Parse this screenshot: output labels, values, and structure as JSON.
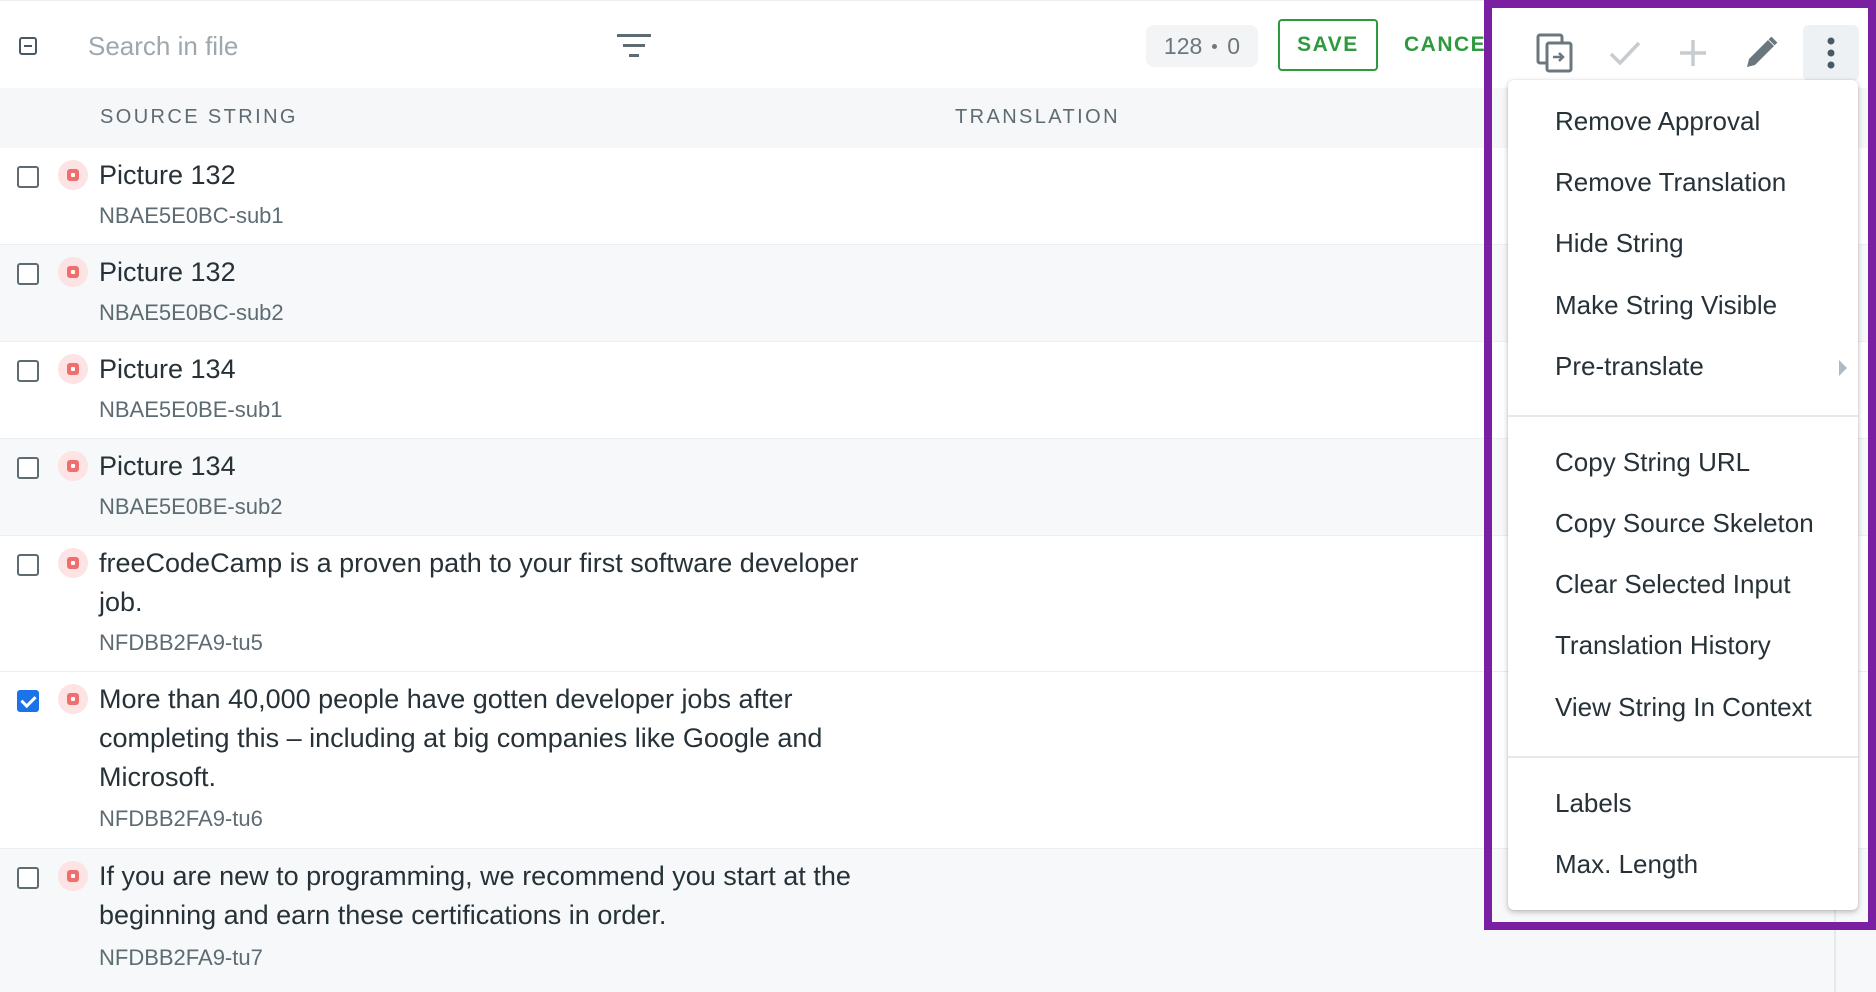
{
  "toolbar": {
    "search_placeholder": "Search in file",
    "count_left": "128",
    "count_right": "0",
    "save_label": "SAVE",
    "cancel_label": "CANCEL"
  },
  "table": {
    "source_header": "SOURCE STRING",
    "translation_header": "TRANSLATION"
  },
  "rows": [
    {
      "text": "Picture 132",
      "id": "NBAE5E0BC-sub1",
      "checked": false
    },
    {
      "text": "Picture 132",
      "id": "NBAE5E0BC-sub2",
      "checked": false
    },
    {
      "text": "Picture 134",
      "id": "NBAE5E0BE-sub1",
      "checked": false
    },
    {
      "text": "Picture 134",
      "id": "NBAE5E0BE-sub2",
      "checked": false
    },
    {
      "text": "freeCodeCamp is a proven path to your first software developer job.",
      "id": "NFDBB2FA9-tu5",
      "checked": false
    },
    {
      "text": "More than 40,000 people have gotten developer jobs after completing this – including at big companies like Google and Microsoft.",
      "id": "NFDBB2FA9-tu6",
      "checked": true
    },
    {
      "text": "If you are new to programming, we recommend you start at the beginning and earn these certifications in order.",
      "id": "NFDBB2FA9-tu7",
      "checked": false
    }
  ],
  "right_toolbar": {
    "icons": [
      "copy-source-icon",
      "approve-check-icon",
      "add-icon",
      "edit-pencil-icon",
      "more-vertical-icon"
    ]
  },
  "menu": {
    "group1": [
      "Remove Approval",
      "Remove Translation",
      "Hide String",
      "Make String Visible",
      "Pre-translate"
    ],
    "group2": [
      "Copy String URL",
      "Copy Source Skeleton",
      "Clear Selected Input",
      "Translation History",
      "View String In Context"
    ],
    "group3": [
      "Labels",
      "Max. Length"
    ]
  },
  "colors": {
    "accent_green": "#2e9a3e",
    "highlight_purple": "#7a1fa2",
    "checkbox_blue": "#1a73e8",
    "status_red": "#ef6f6f"
  }
}
